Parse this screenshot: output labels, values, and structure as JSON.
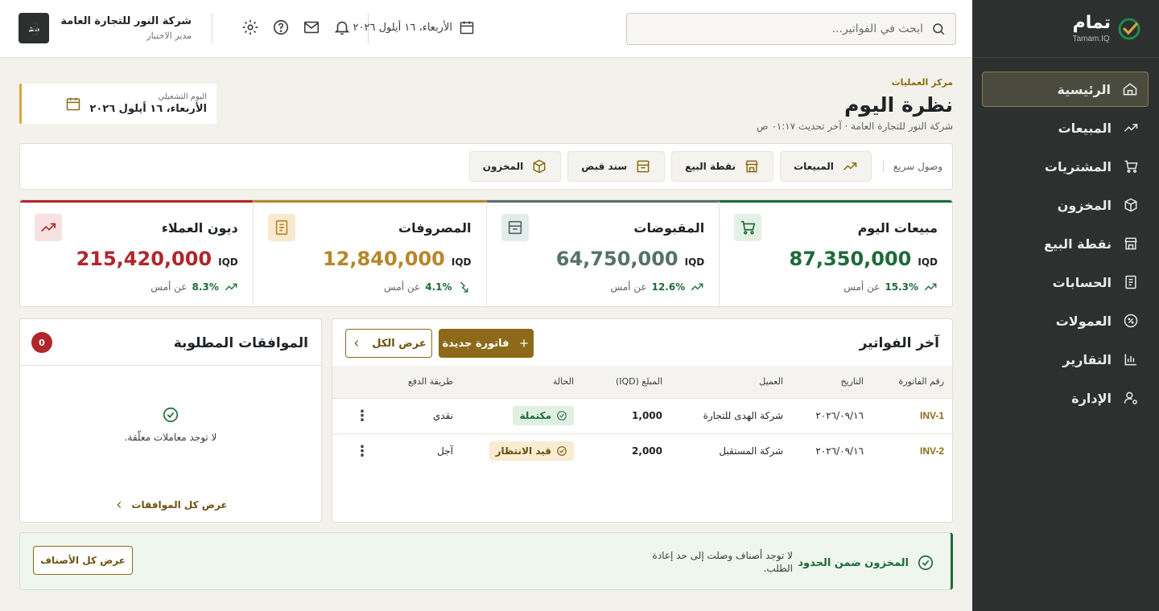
{
  "brand": {
    "name": "تمام",
    "sub": "Tamam.IQ"
  },
  "sidebar": {
    "items": [
      {
        "label": "الرئيسية",
        "icon": "home-icon",
        "active": true
      },
      {
        "label": "المبيعات",
        "icon": "trend-up-icon"
      },
      {
        "label": "المشتريات",
        "icon": "cart-icon"
      },
      {
        "label": "المخزون",
        "icon": "box-icon"
      },
      {
        "label": "نقطة البيع",
        "icon": "store-icon"
      },
      {
        "label": "الحسابات",
        "icon": "ledger-icon"
      },
      {
        "label": "العمولات",
        "icon": "percent-icon"
      },
      {
        "label": "التقارير",
        "icon": "bar-chart-icon"
      },
      {
        "label": "الإدارة",
        "icon": "user-gear-icon"
      }
    ]
  },
  "header": {
    "search_placeholder": "ابحث في الفواتير...",
    "date": "الأربعاء، ١٦ أيلول ٢٠٢٦",
    "company": "شركة النور للتجارة العامة",
    "role": "مدير الاختبار",
    "avatar": "مد"
  },
  "page": {
    "eyebrow": "مركز العمليات",
    "title": "نظرة اليوم",
    "subtitle": "شركة النور للتجارة العامة · آخر تحديث ٠١:١٧ ص",
    "op_day_label": "اليوم التشغيلي",
    "op_day_value": "الأربعاء، ١٦ أيلول ٢٠٢٦"
  },
  "quick": {
    "label": "وصول سريع",
    "buttons": [
      "المبيعات",
      "نقطة البيع",
      "سند قبض",
      "المخزون"
    ]
  },
  "kpis": [
    {
      "title": "مبيعات اليوم",
      "currency": "IQD",
      "value": "87,350,000",
      "delta": "15.3%",
      "vs": "عن أمس",
      "color": "#1e6a39"
    },
    {
      "title": "المقبوضات",
      "currency": "IQD",
      "value": "64,750,000",
      "delta": "12.6%",
      "vs": "عن أمس",
      "color": "#5a6d6a"
    },
    {
      "title": "المصروفات",
      "currency": "IQD",
      "value": "12,840,000",
      "delta": "4.1%",
      "vs": "عن أمس",
      "color": "#b8862a"
    },
    {
      "title": "ديون العملاء",
      "currency": "IQD",
      "value": "215,420,000",
      "delta": "8.3%",
      "vs": "عن أمس",
      "color": "#b0262c"
    }
  ],
  "invoices": {
    "title": "آخر الفواتير",
    "new_label": "فاتورة جديدة",
    "all_label": "عرض الكل",
    "columns": [
      "رقم الفاتورة",
      "التاريخ",
      "العميل",
      "المبلغ (IQD)",
      "الحالة",
      "طريقة الدفع"
    ],
    "rows": [
      {
        "id": "INV-1",
        "date": "٢٠٢٦/٠٩/١٦",
        "client": "شركة الهدى للتجارة",
        "amount": "1,000",
        "status": "مكتملة",
        "pay": "نقدي"
      },
      {
        "id": "INV-2",
        "date": "٢٠٢٦/٠٩/١٦",
        "client": "شركة المستقبل",
        "amount": "2,000",
        "status": "قيد الانتظار",
        "pay": "آجل"
      }
    ]
  },
  "approvals": {
    "title": "الموافقات المطلوبة",
    "count": "0",
    "empty": "لا توجد معاملات معلّقة.",
    "link": "عرض كل الموافقات"
  },
  "stock": {
    "title": "المخزون ضمن الحدود",
    "desc": "لا توجد أصناف وصلت إلى حد إعادة الطلب.",
    "button": "عرض كل الأصناف"
  },
  "colors": {
    "accent": "#8c6a1a",
    "sidebar": "#2c302e",
    "success": "#1e6a39",
    "danger": "#b0262c"
  }
}
